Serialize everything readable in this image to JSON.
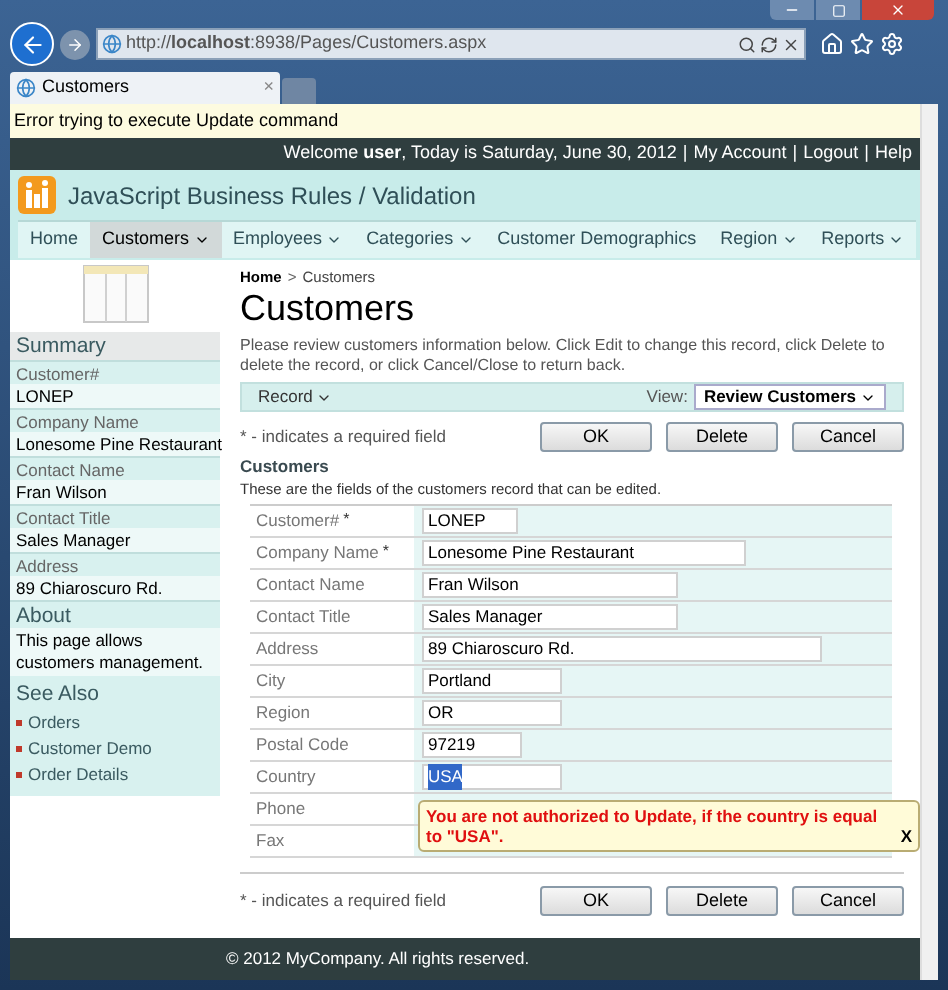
{
  "browser": {
    "url": "http://**localhost**:8938/Pages/Customers.aspx",
    "tab_title": "Customers",
    "tab_close": "×"
  },
  "error_bar": "Error trying to execute Update command",
  "top_bar": [
    {
      "kind": "text",
      "text": "Welcome **user**, Today is Saturday, June 30, 2012"
    },
    {
      "kind": "separator",
      "text": "|"
    },
    {
      "kind": "link",
      "text": "My Account"
    },
    {
      "kind": "separator",
      "text": "|"
    },
    {
      "kind": "link",
      "text": "Logout"
    },
    {
      "kind": "separator",
      "text": "|"
    },
    {
      "kind": "link",
      "text": "Help"
    }
  ],
  "app_title": "JavaScript Business Rules / Validation",
  "menu": [
    {
      "label": "Home",
      "has_menu": false,
      "selected": false
    },
    {
      "label": "Customers",
      "has_menu": true,
      "selected": true
    },
    {
      "label": "Employees",
      "has_menu": true,
      "selected": false
    },
    {
      "label": "Categories",
      "has_menu": true,
      "selected": false
    },
    {
      "label": "Customer Demographics",
      "has_menu": false,
      "selected": false
    },
    {
      "label": "Region",
      "has_menu": true,
      "selected": false
    },
    {
      "label": "Reports",
      "has_menu": true,
      "selected": false
    }
  ],
  "sidebar": {
    "summary_title": "Summary",
    "summary": [
      {
        "label": "Customer#",
        "value": "LONEP"
      },
      {
        "label": "Company Name",
        "value": "Lonesome Pine Restaurant"
      },
      {
        "label": "Contact Name",
        "value": "Fran Wilson"
      },
      {
        "label": "Contact Title",
        "value": "Sales Manager"
      },
      {
        "label": "Address",
        "value": "89 Chiaroscuro Rd."
      }
    ],
    "about_title": "About",
    "about_text": "This page allows customers management.",
    "see_also_title": "See Also",
    "see_also": [
      "Orders",
      "Customer Demo",
      "Order Details"
    ]
  },
  "breadcrumb": [
    {
      "kind": "link",
      "text": "Home"
    },
    {
      "kind": "separator",
      "text": ">"
    },
    {
      "kind": "text",
      "text": "Customers"
    }
  ],
  "page_title": "Customers",
  "description": "Please review customers information below. Click Edit to change this record, click Delete to delete the record, or click Cancel/Close to return back.",
  "action_bar": {
    "record_menu": "Record",
    "view_label": "View:",
    "view_value": "Review Customers"
  },
  "required_note_top": "* - indicates a required field",
  "buttons_top": [
    "OK",
    "Delete",
    "Cancel"
  ],
  "section_title": "Customers",
  "section_description": "These are the fields of the customers record that can be edited.",
  "fields": [
    {
      "label": "Customer#",
      "required": true,
      "value": "LONEP",
      "text_selected": false
    },
    {
      "label": "Company Name",
      "required": true,
      "value": "Lonesome Pine Restaurant",
      "text_selected": false
    },
    {
      "label": "Contact Name",
      "required": false,
      "value": "Fran Wilson",
      "text_selected": false
    },
    {
      "label": "Contact Title",
      "required": false,
      "value": "Sales Manager",
      "text_selected": false
    },
    {
      "label": "Address",
      "required": false,
      "value": "89 Chiaroscuro Rd.",
      "text_selected": false
    },
    {
      "label": "City",
      "required": false,
      "value": "Portland",
      "text_selected": false
    },
    {
      "label": "Region",
      "required": false,
      "value": "OR",
      "text_selected": false
    },
    {
      "label": "Postal Code",
      "required": false,
      "value": "97219",
      "text_selected": false
    },
    {
      "label": "Country",
      "required": false,
      "value": "USA",
      "text_selected": true
    },
    {
      "label": "Phone",
      "required": false
    },
    {
      "label": "Fax",
      "required": false
    }
  ],
  "required_mark": "*",
  "tooltip": {
    "message": "You are not authorized to Update, if the country is equal to \"USA\".",
    "close": "X"
  },
  "required_note_bottom": "* - indicates a required field",
  "buttons_bottom": [
    "OK",
    "Delete",
    "Cancel"
  ],
  "footer": "© 2012 MyCompany. All rights reserved."
}
